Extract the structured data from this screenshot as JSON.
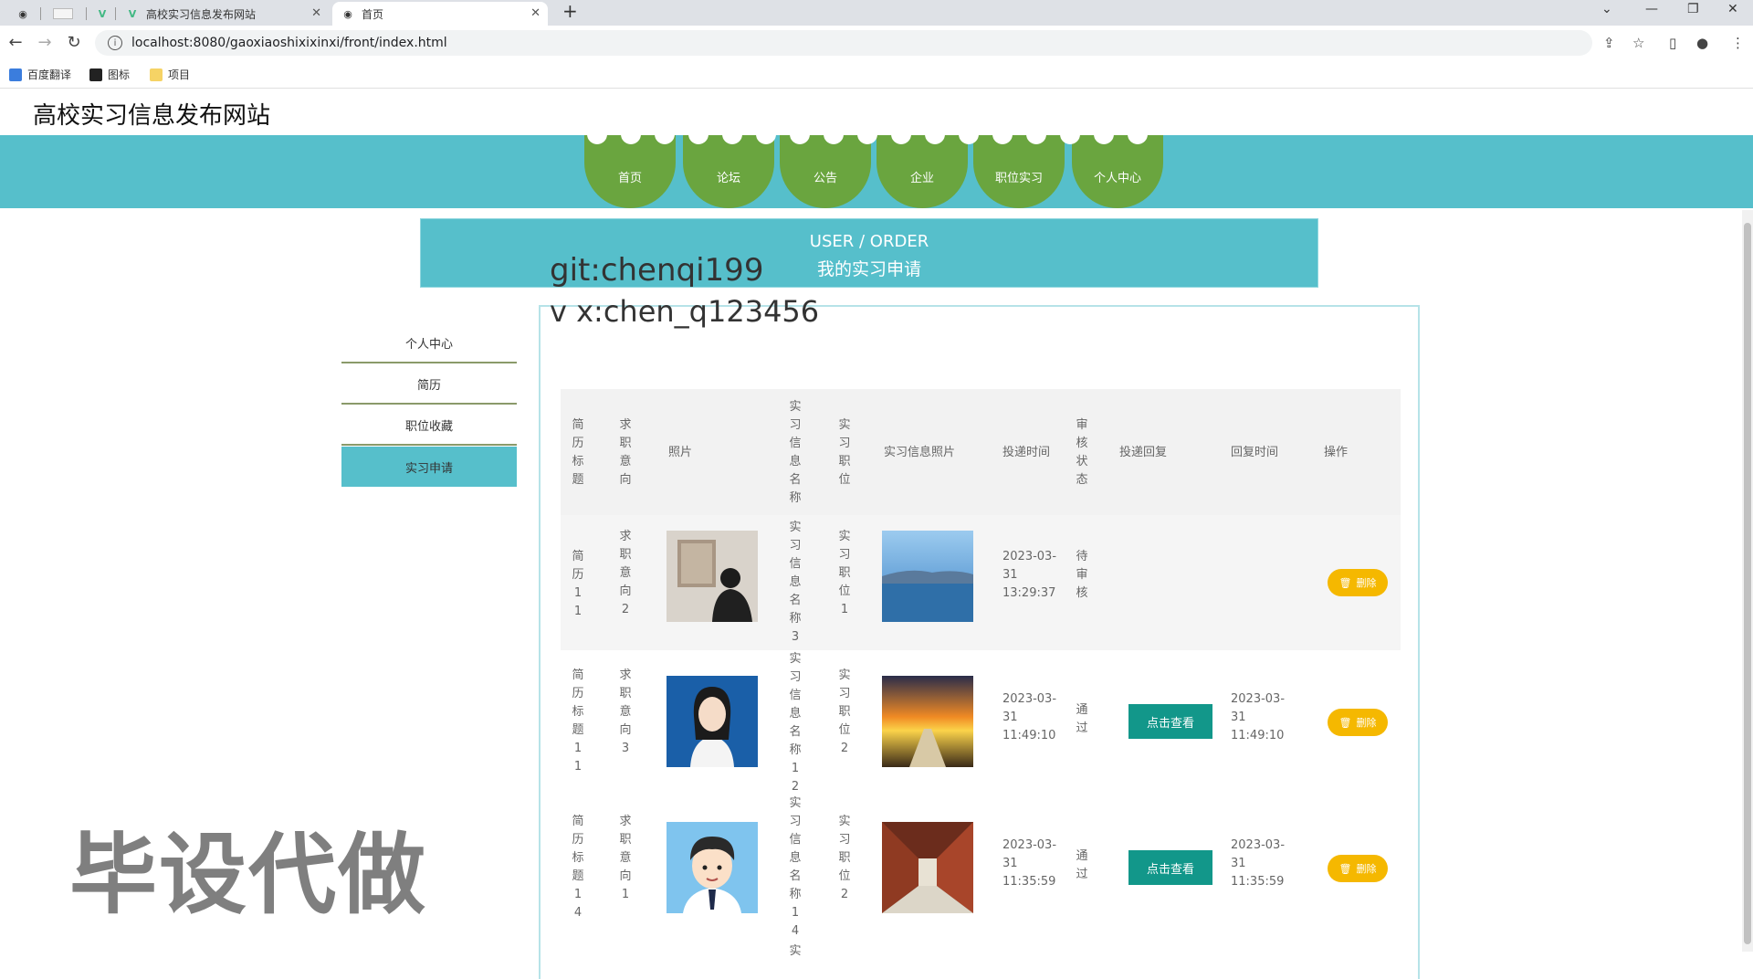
{
  "browser": {
    "tabs": [
      {
        "title": ""
      },
      {
        "title": ""
      },
      {
        "title": ""
      },
      {
        "title": "高校实习信息发布网站"
      },
      {
        "title": "首页"
      }
    ],
    "new_tab_label": "+",
    "url": "localhost:8080/gaoxiaoshixixinxi/front/index.html",
    "bookmarks": [
      "百度翻译",
      "图标",
      "项目"
    ]
  },
  "site": {
    "title": "高校实习信息发布网站",
    "nav": [
      "首页",
      "论坛",
      "公告",
      "企业",
      "职位实习",
      "个人中心"
    ]
  },
  "header": {
    "en": "USER / ORDER",
    "cn": "我的实习申请"
  },
  "overlay": {
    "line1": "git:chenqi199",
    "line2": "v x:chen_q123456",
    "watermark": "毕设代做"
  },
  "sidebar": {
    "items": [
      "个人中心",
      "简历",
      "职位收藏",
      "实习申请"
    ],
    "active": "实习申请"
  },
  "table": {
    "headers": [
      "简历标题",
      "求职意向",
      "照片",
      "实习信息名称",
      "实习职位",
      "实习信息照片",
      "投递时间",
      "审核状态",
      "投递回复",
      "回复时间",
      "操作"
    ],
    "rows": [
      {
        "resume": "简历11",
        "intent": "求职意向2",
        "info_name": "实习信息名称3",
        "position": "实习职位1",
        "submit_time": [
          "2023-03-",
          "31",
          "13:29:37"
        ],
        "status": "待审核",
        "reply": "",
        "reply_time": [
          "",
          "",
          ""
        ],
        "delete": "删除"
      },
      {
        "resume": "简历标题11",
        "intent": "求职意向3",
        "info_name": "实习信息名称12",
        "position": "实习职位2",
        "submit_time": [
          "2023-03-",
          "31",
          "11:49:10"
        ],
        "status": "通过",
        "reply": "点击查看",
        "reply_time": [
          "2023-03-",
          "31",
          "11:49:10"
        ],
        "delete": "删除"
      },
      {
        "resume": "简历标题14",
        "intent": "求职意向1",
        "info_name": "实习信息名称14",
        "position": "实习职位2",
        "submit_time": [
          "2023-03-",
          "31",
          "11:35:59"
        ],
        "status": "通过",
        "reply": "点击查看",
        "reply_time": [
          "2023-03-",
          "31",
          "11:35:59"
        ],
        "delete": "删除"
      }
    ],
    "partial_row_first_char": "实"
  },
  "colors": {
    "nav_band": "#56bfcb",
    "nav_item": "#6aa53f",
    "view_button": "#12978a",
    "delete_button": "#f5b800"
  }
}
